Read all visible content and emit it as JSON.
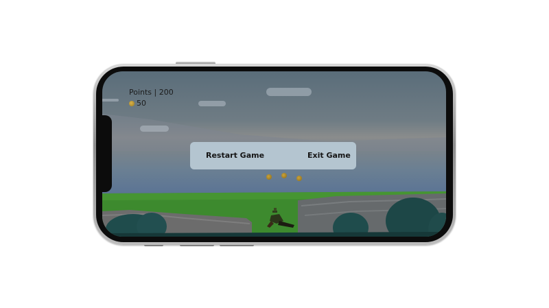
{
  "hud": {
    "points_label": "Points | 200",
    "coins_value": "50"
  },
  "menu": {
    "restart_label": "Restart Game",
    "exit_label": "Exit Game"
  },
  "colors": {
    "grass": "#3d8a2e",
    "stone": "#6d6d6d",
    "bush": "#1e4a4a",
    "menu_bg": "#b4c5d0",
    "coin": "#b8952e"
  },
  "icons": {
    "coin": "coin-icon"
  }
}
